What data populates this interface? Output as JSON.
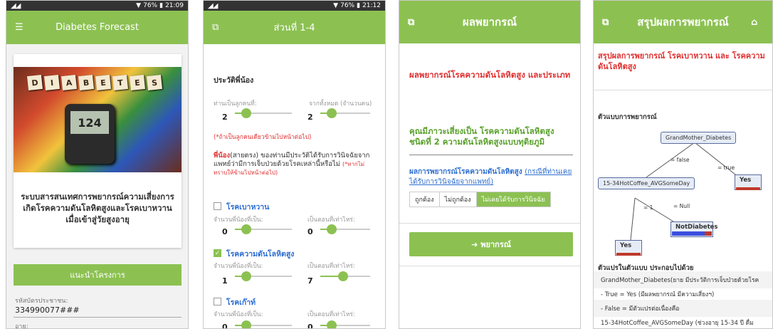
{
  "status_bar": {
    "battery_1": "76%",
    "time_1": "21:09",
    "battery_2": "76%",
    "time_2": "21:12"
  },
  "screen1": {
    "app_title": "Diabetes Forecast",
    "hero_letters": [
      "D",
      "I",
      "A",
      "B",
      "E",
      "T",
      "E",
      "S"
    ],
    "meter_reading": "124",
    "card_title": "ระบบสารสนเทศการพยากรณ์ความเสี่ยงการเกิดโรคความดันโลหิตสูงและโรคเบาหวานเมื่อเข้าสู่วัยสูงอายุ",
    "intro_button": "แนะนำโครงการ",
    "id_label": "รหัสบัตรประชาชน:",
    "id_value": "334990077###",
    "next_label": "อายุ:"
  },
  "screen2": {
    "title": "ส่วนที่ 1-4",
    "section": "ประวัติพี่น้อง",
    "q_order_label": "ท่านเป็นลูกคนที่:",
    "q_order_value": "2",
    "q_total_label": "จากทั้งหมด (จำนวนคน)",
    "q_total_value": "2",
    "note": "(*ถ้าเป็นลูกคนเดียวข้ามไปหน้าต่อไป)",
    "para_red": "พี่น้อง",
    "para_text": "(สายตรง) ของท่านมีประวัติได้รับการวินิจฉัยจากแพทย์ว่ามีการเจ็บป่วยด้วยโรคเหล่านี้หรือไม่",
    "para_note": "(*หากไม่ทราบให้ข้ามไปหน้าต่อไป)",
    "diseases": [
      {
        "label": "โรคเบาหวาน",
        "checked": false,
        "count_label": "จำนวนพี่น้องที่เป็น:",
        "count": "0",
        "age_label": "เป็นตอนที่เท่าไหร่:",
        "age": "0"
      },
      {
        "label": "โรคความดันโลหิตสูง",
        "checked": true,
        "count_label": "จำนวนพี่น้องที่เป็น:",
        "count": "1",
        "age_label": "เป็นตอนที่เท่าไหร่:",
        "age": "7"
      },
      {
        "label": "โรคเก๊าท์",
        "checked": false,
        "count_label": "จำนวนพี่น้องที่เป็น:",
        "count": "0",
        "age_label": "เป็นตอนที่เท่าไหร่:",
        "age": "0"
      }
    ]
  },
  "screen3": {
    "title": "ผลพยากรณ์",
    "result_title": "ผลพยากรณ์โรคความดันโลหิตสูง และประเภท",
    "risk_text": "คุณมีภาวะเสี่ยงเป็น โรคความดันโลหิตสูง ชนิดที่ 2 ความดันโลหิตสูงแบบทุติยภูมิ",
    "confirm_label": "ผลการพยากรณ์โรคความดันโลหิตสูง",
    "confirm_link": "(กรณีที่ท่านเคยได้รับการวินิจฉัยจากแพทย์)",
    "options": [
      "ถูกต้อง",
      "ไม่ถูกต้อง",
      "ไม่เคยได้รับการวินิจฉัย"
    ],
    "selected_option": "ไม่เคยได้รับการวินิจฉัย",
    "predict_button": "พยากรณ์"
  },
  "screen4": {
    "title": "สรุปผลการพยากรณ์",
    "heading": "สรุปผลการพยากรณ์ โรคเบาหวาน และ โรคความดันโลหิตสูง",
    "model_label": "ตัวแบบการพยากรณ์",
    "tree": {
      "root": "GrandMother_Diabetes",
      "edge_false": "= false",
      "edge_true": "= true",
      "node2": "15-34HotCoffee_AVGSomeDay",
      "edge_1": "= 1",
      "edge_null": "= Null",
      "leaf_yes_right": "Yes",
      "leaf_yes_left": "Yes",
      "leaf_notdiabetes": "NotDiabetes"
    },
    "vars_label": "ตัวแปรในตัวแบบ ประกอบไปด้วย",
    "vars": [
      "GrandMother_Diabetes(ยาย มีประวัติการเจ็บป่วยด้วยโรค",
      "- True = Yes (มีผลพยากรณ์ มีความเสี่ยงฯ)",
      "- False = มีตัวแปรต่อเนื่องคือ",
      "15-34HotCoffee_AVGSomeDay (ช่วงอายุ 15-34 ปี ดื่ม"
    ]
  }
}
